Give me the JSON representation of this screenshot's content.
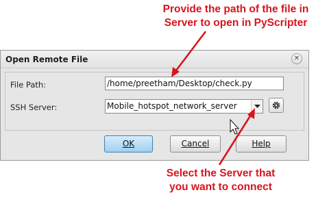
{
  "annotations": {
    "top": [
      "Provide the path of the file in",
      "Server to open in PyScripter"
    ],
    "bottom": [
      "Select the Server that",
      "you want to connect"
    ],
    "color": "#d8141e"
  },
  "dialog": {
    "title": "Open Remote File",
    "close_icon": "close-icon",
    "file_path_label": "File Path:",
    "file_path_value": "/home/preetham/Desktop/check.py",
    "ssh_server_label": "SSH Server:",
    "ssh_server_value": "Mobile_hotspot_network_server",
    "dropdown_icon": "chevron-down-icon",
    "settings_icon": "gear-icon",
    "buttons": {
      "ok": "OK",
      "cancel": "Cancel",
      "help": "Help"
    },
    "ok_accent": "#9fd0f2"
  }
}
